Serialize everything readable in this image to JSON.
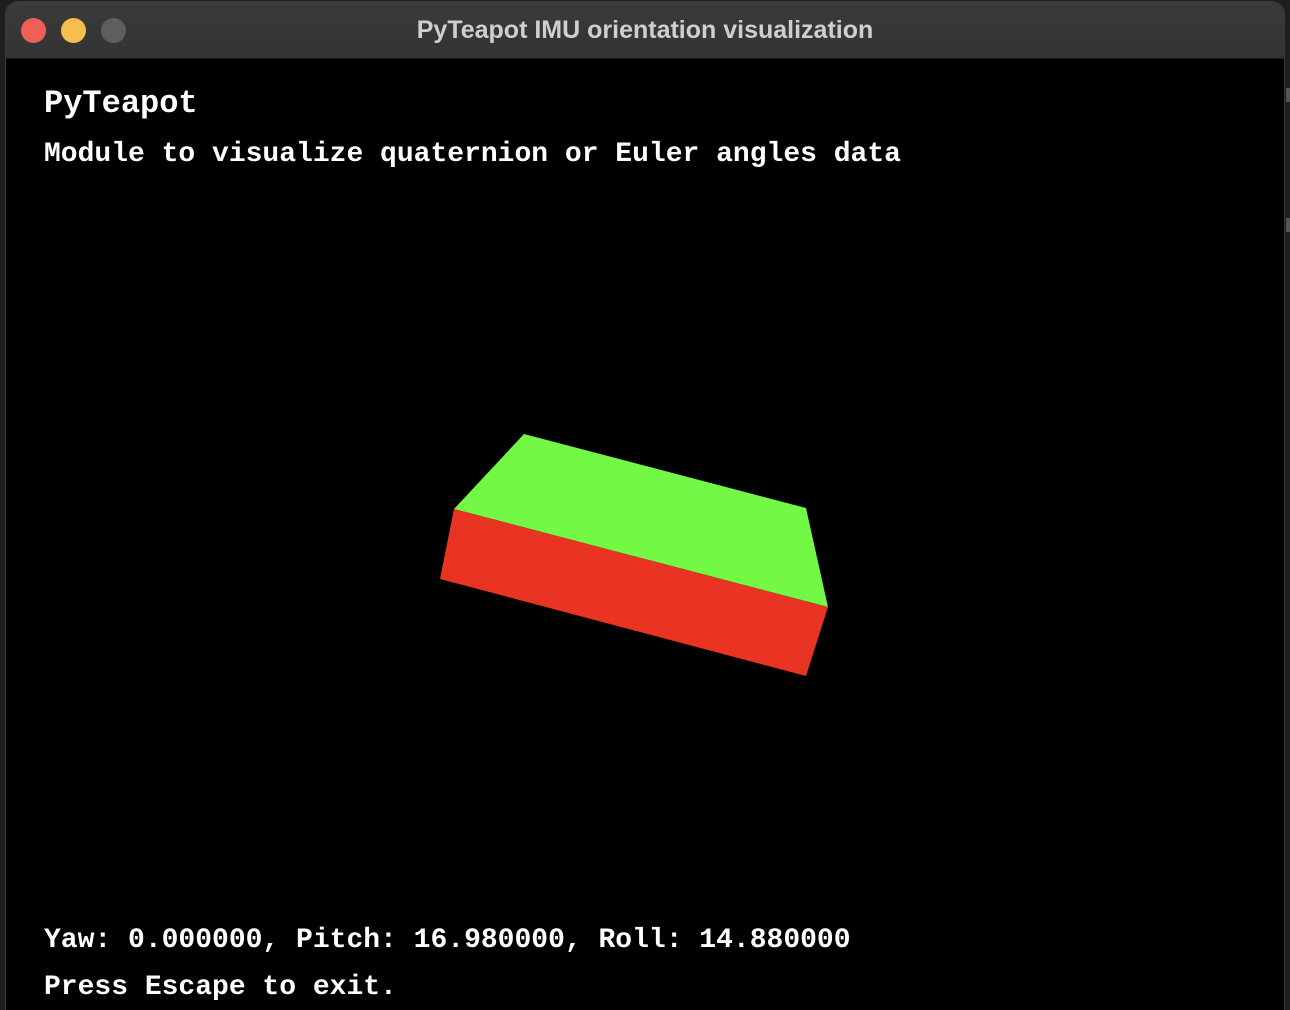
{
  "window": {
    "title": "PyTeapot IMU orientation visualization"
  },
  "controls": {
    "close_color": "#ed5f57",
    "minimize_color": "#f4bf4f",
    "zoom_color": "#5e5e5e"
  },
  "scene": {
    "heading": "PyTeapot",
    "subtitle": "Module to visualize quaternion or Euler angles data",
    "top_face_color": "#72f845",
    "front_face_color": "#e93323",
    "background_color": "#000000"
  },
  "status": {
    "angles_text": "Yaw: 0.000000, Pitch: 16.980000, Roll: 14.880000",
    "hint_text": "Press Escape to exit."
  },
  "orientation": {
    "yaw": 0.0,
    "pitch": 16.98,
    "roll": 14.88
  }
}
